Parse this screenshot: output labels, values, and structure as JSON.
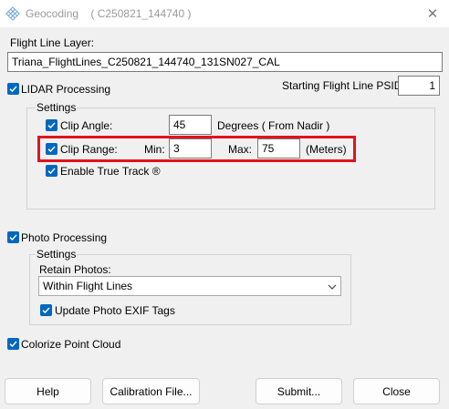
{
  "window": {
    "title": "Geocoding    ( C250821_144740 )",
    "close_glyph": "✕",
    "app_icon": "diamond-grid-icon"
  },
  "flight_line_layer": {
    "label": "Flight Line Layer:",
    "value": "Triana_FlightLines_C250821_144740_131SN027_CAL"
  },
  "lidar": {
    "checkbox_label": "LIDAR Processing",
    "checked": true,
    "psid_label": "Starting Flight Line PSID:",
    "psid_value": "1",
    "settings": {
      "title": "Settings",
      "clip_angle": {
        "label": "Clip Angle:",
        "checked": true,
        "value": "45",
        "unit": "Degrees ( From Nadir )"
      },
      "clip_range": {
        "label": "Clip Range:",
        "checked": true,
        "min_label": "Min:",
        "min_value": "3",
        "max_label": "Max:",
        "max_value": "75",
        "unit": "(Meters)"
      },
      "true_track": {
        "label": "Enable True Track ®",
        "checked": true
      }
    }
  },
  "photo": {
    "checkbox_label": "Photo Processing",
    "checked": true,
    "settings": {
      "title": "Settings",
      "retain_label": "Retain Photos:",
      "retain_value": "Within Flight Lines",
      "exif_label": "Update Photo EXIF Tags",
      "exif_checked": true
    }
  },
  "colorize": {
    "checkbox_label": "Colorize Point Cloud",
    "checked": true
  },
  "buttons": {
    "help": "Help",
    "calibration": "Calibration File...",
    "submit": "Submit...",
    "close": "Close"
  },
  "colors": {
    "accent": "#0067c0",
    "highlight": "#e0141e"
  }
}
